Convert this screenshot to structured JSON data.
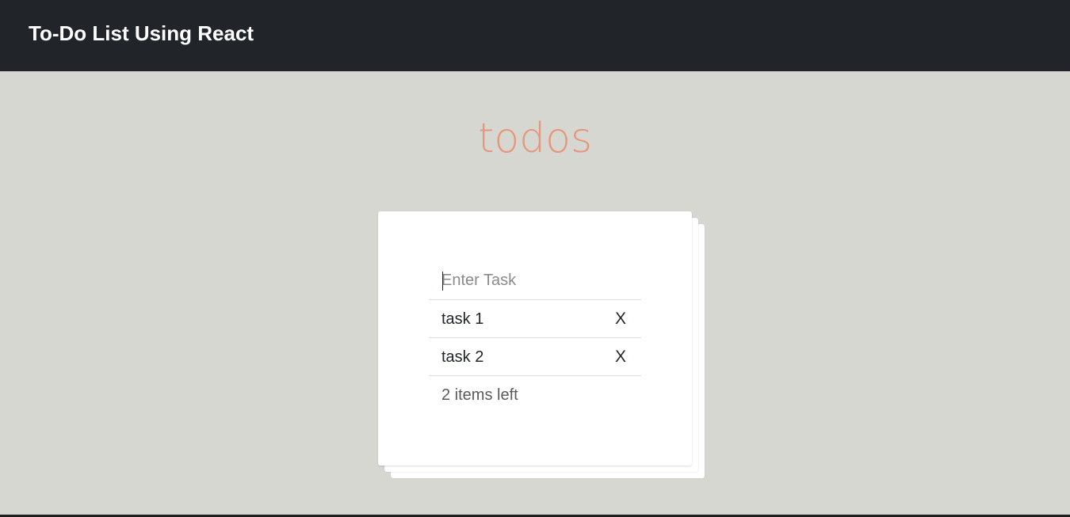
{
  "navbar": {
    "brand": "To-Do List Using React"
  },
  "main": {
    "heading": "todos"
  },
  "todo": {
    "input_placeholder": "Enter Task",
    "input_value": "",
    "items": [
      {
        "label": "task 1",
        "delete_label": "X"
      },
      {
        "label": "task 2",
        "delete_label": "X"
      }
    ],
    "items_left": "2 items left"
  },
  "colors": {
    "navbar_bg": "#212529",
    "page_bg": "#d7d7d2",
    "heading": "#e4977b",
    "card_bg": "#ffffff"
  }
}
